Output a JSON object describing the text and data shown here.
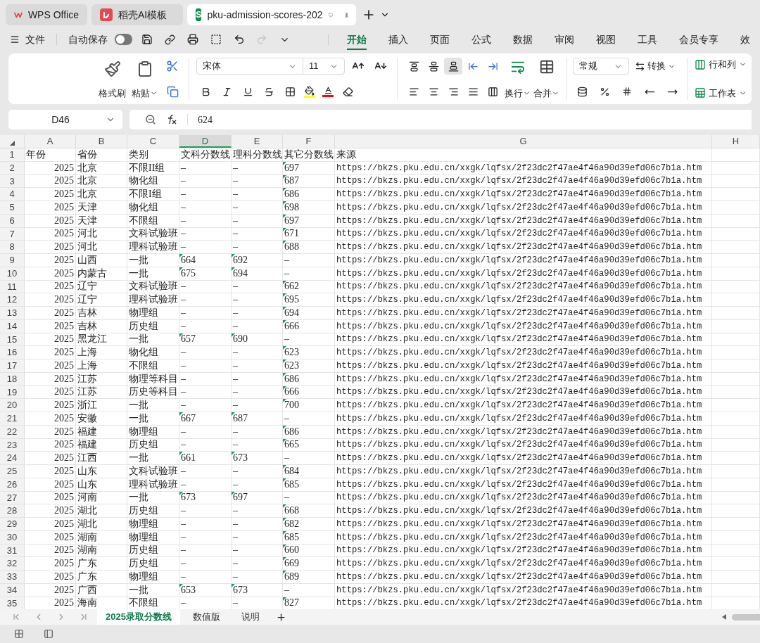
{
  "browser_tabs": [
    {
      "kind": "wps",
      "label": "WPS Office",
      "selected": false
    },
    {
      "kind": "docer",
      "label": "稻壳AI模板",
      "selected": false
    },
    {
      "kind": "sheet",
      "label": "pku-admission-scores-202",
      "icon_letter": "S",
      "selected": true,
      "modified": true
    }
  ],
  "quick_bar": {
    "file_label": "文件",
    "autosave_label": "自动保存",
    "autosave_on": false,
    "redo_disabled": true
  },
  "ribbon_tabs": [
    {
      "label": "开始",
      "selected": true
    },
    {
      "label": "插入",
      "selected": false
    },
    {
      "label": "页面",
      "selected": false
    },
    {
      "label": "公式",
      "selected": false
    },
    {
      "label": "数据",
      "selected": false
    },
    {
      "label": "审阅",
      "selected": false
    },
    {
      "label": "视图",
      "selected": false
    },
    {
      "label": "工具",
      "selected": false
    },
    {
      "label": "会员专享",
      "selected": false
    },
    {
      "label": "效",
      "selected": false
    }
  ],
  "ribbon": {
    "format_painter": "格式刷",
    "paste": "粘贴",
    "font_name": "宋体",
    "font_size": "11",
    "vertical_align_selected": [
      false,
      false,
      true
    ],
    "wrap": "换行",
    "merge": "合并",
    "number_format": "常规",
    "convert": "转换",
    "rows_cols": "行和列",
    "worksheet": "工作表"
  },
  "formula_bar": {
    "cell_ref": "D46",
    "formula": "624"
  },
  "sheet": {
    "columns": [
      {
        "label": "A",
        "selected": false
      },
      {
        "label": "B",
        "selected": false
      },
      {
        "label": "C",
        "selected": false
      },
      {
        "label": "D",
        "selected": true
      },
      {
        "label": "E",
        "selected": false
      },
      {
        "label": "F",
        "selected": false
      },
      {
        "label": "G",
        "selected": false
      },
      {
        "label": "H",
        "selected": false
      }
    ],
    "rows": [
      {
        "number": "1",
        "kind": "header",
        "cells": [
          "年份",
          "省份",
          "类别",
          "文科分数线",
          "理科分数线",
          "其它分数线",
          "来源"
        ],
        "flags": [
          false,
          false,
          false,
          false,
          false,
          false,
          false
        ]
      },
      {
        "number": "2",
        "kind": "data",
        "cells": [
          "2025",
          "北京",
          "不限II组",
          "–",
          "–",
          "697",
          "https://bkzs.pku.edu.cn/xxgk/lqfsx/2f23dc2f47ae4f46a90d39efd06c7b1a.htm"
        ],
        "flags": [
          false,
          false,
          false,
          false,
          false,
          true,
          false
        ]
      },
      {
        "number": "3",
        "kind": "data",
        "cells": [
          "2025",
          "北京",
          "物化组",
          "–",
          "–",
          "687",
          "https://bkzs.pku.edu.cn/xxgk/lqfsx/2f23dc2f47ae4f46a90d39efd06c7b1a.htm"
        ],
        "flags": [
          false,
          false,
          false,
          false,
          false,
          true,
          false
        ]
      },
      {
        "number": "4",
        "kind": "data",
        "cells": [
          "2025",
          "北京",
          "不限I组",
          "–",
          "–",
          "686",
          "https://bkzs.pku.edu.cn/xxgk/lqfsx/2f23dc2f47ae4f46a90d39efd06c7b1a.htm"
        ],
        "flags": [
          false,
          false,
          false,
          false,
          false,
          true,
          false
        ]
      },
      {
        "number": "5",
        "kind": "data",
        "cells": [
          "2025",
          "天津",
          "物化组",
          "–",
          "–",
          "698",
          "https://bkzs.pku.edu.cn/xxgk/lqfsx/2f23dc2f47ae4f46a90d39efd06c7b1a.htm"
        ],
        "flags": [
          false,
          false,
          false,
          false,
          false,
          true,
          false
        ]
      },
      {
        "number": "6",
        "kind": "data",
        "cells": [
          "2025",
          "天津",
          "不限组",
          "–",
          "–",
          "697",
          "https://bkzs.pku.edu.cn/xxgk/lqfsx/2f23dc2f47ae4f46a90d39efd06c7b1a.htm"
        ],
        "flags": [
          false,
          false,
          false,
          false,
          false,
          true,
          false
        ]
      },
      {
        "number": "7",
        "kind": "data",
        "cells": [
          "2025",
          "河北",
          "文科试验班",
          "–",
          "–",
          "671",
          "https://bkzs.pku.edu.cn/xxgk/lqfsx/2f23dc2f47ae4f46a90d39efd06c7b1a.htm"
        ],
        "flags": [
          false,
          false,
          false,
          false,
          false,
          true,
          false
        ]
      },
      {
        "number": "8",
        "kind": "data",
        "cells": [
          "2025",
          "河北",
          "理科试验班",
          "–",
          "–",
          "688",
          "https://bkzs.pku.edu.cn/xxgk/lqfsx/2f23dc2f47ae4f46a90d39efd06c7b1a.htm"
        ],
        "flags": [
          false,
          false,
          false,
          false,
          false,
          true,
          false
        ]
      },
      {
        "number": "9",
        "kind": "data",
        "cells": [
          "2025",
          "山西",
          "一批",
          "664",
          "692",
          "–",
          "https://bkzs.pku.edu.cn/xxgk/lqfsx/2f23dc2f47ae4f46a90d39efd06c7b1a.htm"
        ],
        "flags": [
          false,
          false,
          false,
          true,
          true,
          false,
          false
        ]
      },
      {
        "number": "10",
        "kind": "data",
        "cells": [
          "2025",
          "内蒙古",
          "一批",
          "675",
          "694",
          "–",
          "https://bkzs.pku.edu.cn/xxgk/lqfsx/2f23dc2f47ae4f46a90d39efd06c7b1a.htm"
        ],
        "flags": [
          false,
          false,
          false,
          true,
          true,
          false,
          false
        ]
      },
      {
        "number": "11",
        "kind": "data",
        "cells": [
          "2025",
          "辽宁",
          "文科试验班",
          "–",
          "–",
          "662",
          "https://bkzs.pku.edu.cn/xxgk/lqfsx/2f23dc2f47ae4f46a90d39efd06c7b1a.htm"
        ],
        "flags": [
          false,
          false,
          false,
          false,
          false,
          true,
          false
        ]
      },
      {
        "number": "12",
        "kind": "data",
        "cells": [
          "2025",
          "辽宁",
          "理科试验班",
          "–",
          "–",
          "695",
          "https://bkzs.pku.edu.cn/xxgk/lqfsx/2f23dc2f47ae4f46a90d39efd06c7b1a.htm"
        ],
        "flags": [
          false,
          false,
          false,
          false,
          false,
          true,
          false
        ]
      },
      {
        "number": "13",
        "kind": "data",
        "cells": [
          "2025",
          "吉林",
          "物理组",
          "–",
          "–",
          "694",
          "https://bkzs.pku.edu.cn/xxgk/lqfsx/2f23dc2f47ae4f46a90d39efd06c7b1a.htm"
        ],
        "flags": [
          false,
          false,
          false,
          false,
          false,
          true,
          false
        ]
      },
      {
        "number": "14",
        "kind": "data",
        "cells": [
          "2025",
          "吉林",
          "历史组",
          "–",
          "–",
          "666",
          "https://bkzs.pku.edu.cn/xxgk/lqfsx/2f23dc2f47ae4f46a90d39efd06c7b1a.htm"
        ],
        "flags": [
          false,
          false,
          false,
          false,
          false,
          true,
          false
        ]
      },
      {
        "number": "15",
        "kind": "data",
        "cells": [
          "2025",
          "黑龙江",
          "一批",
          "657",
          "690",
          "–",
          "https://bkzs.pku.edu.cn/xxgk/lqfsx/2f23dc2f47ae4f46a90d39efd06c7b1a.htm"
        ],
        "flags": [
          false,
          false,
          false,
          true,
          true,
          false,
          false
        ]
      },
      {
        "number": "16",
        "kind": "data",
        "cells": [
          "2025",
          "上海",
          "物化组",
          "–",
          "–",
          "623",
          "https://bkzs.pku.edu.cn/xxgk/lqfsx/2f23dc2f47ae4f46a90d39efd06c7b1a.htm"
        ],
        "flags": [
          false,
          false,
          false,
          false,
          false,
          true,
          false
        ]
      },
      {
        "number": "17",
        "kind": "data",
        "cells": [
          "2025",
          "上海",
          "不限组",
          "–",
          "–",
          "623",
          "https://bkzs.pku.edu.cn/xxgk/lqfsx/2f23dc2f47ae4f46a90d39efd06c7b1a.htm"
        ],
        "flags": [
          false,
          false,
          false,
          false,
          false,
          true,
          false
        ]
      },
      {
        "number": "18",
        "kind": "data",
        "cells": [
          "2025",
          "江苏",
          "物理等科目",
          "–",
          "–",
          "686",
          "https://bkzs.pku.edu.cn/xxgk/lqfsx/2f23dc2f47ae4f46a90d39efd06c7b1a.htm"
        ],
        "flags": [
          false,
          false,
          false,
          false,
          false,
          true,
          false
        ]
      },
      {
        "number": "19",
        "kind": "data",
        "cells": [
          "2025",
          "江苏",
          "历史等科目",
          "–",
          "–",
          "666",
          "https://bkzs.pku.edu.cn/xxgk/lqfsx/2f23dc2f47ae4f46a90d39efd06c7b1a.htm"
        ],
        "flags": [
          false,
          false,
          false,
          false,
          false,
          true,
          false
        ]
      },
      {
        "number": "20",
        "kind": "data",
        "cells": [
          "2025",
          "浙江",
          "一批",
          "–",
          "–",
          "700",
          "https://bkzs.pku.edu.cn/xxgk/lqfsx/2f23dc2f47ae4f46a90d39efd06c7b1a.htm"
        ],
        "flags": [
          false,
          false,
          false,
          false,
          false,
          true,
          false
        ]
      },
      {
        "number": "21",
        "kind": "data",
        "cells": [
          "2025",
          "安徽",
          "一批",
          "667",
          "687",
          "–",
          "https://bkzs.pku.edu.cn/xxgk/lqfsx/2f23dc2f47ae4f46a90d39efd06c7b1a.htm"
        ],
        "flags": [
          false,
          false,
          false,
          true,
          true,
          false,
          false
        ]
      },
      {
        "number": "22",
        "kind": "data",
        "cells": [
          "2025",
          "福建",
          "物理组",
          "–",
          "–",
          "686",
          "https://bkzs.pku.edu.cn/xxgk/lqfsx/2f23dc2f47ae4f46a90d39efd06c7b1a.htm"
        ],
        "flags": [
          false,
          false,
          false,
          false,
          false,
          true,
          false
        ]
      },
      {
        "number": "23",
        "kind": "data",
        "cells": [
          "2025",
          "福建",
          "历史组",
          "–",
          "–",
          "665",
          "https://bkzs.pku.edu.cn/xxgk/lqfsx/2f23dc2f47ae4f46a90d39efd06c7b1a.htm"
        ],
        "flags": [
          false,
          false,
          false,
          false,
          false,
          true,
          false
        ]
      },
      {
        "number": "24",
        "kind": "data",
        "cells": [
          "2025",
          "江西",
          "一批",
          "661",
          "673",
          "–",
          "https://bkzs.pku.edu.cn/xxgk/lqfsx/2f23dc2f47ae4f46a90d39efd06c7b1a.htm"
        ],
        "flags": [
          false,
          false,
          false,
          true,
          true,
          false,
          false
        ]
      },
      {
        "number": "25",
        "kind": "data",
        "cells": [
          "2025",
          "山东",
          "文科试验班",
          "–",
          "–",
          "684",
          "https://bkzs.pku.edu.cn/xxgk/lqfsx/2f23dc2f47ae4f46a90d39efd06c7b1a.htm"
        ],
        "flags": [
          false,
          false,
          false,
          false,
          false,
          true,
          false
        ]
      },
      {
        "number": "26",
        "kind": "data",
        "cells": [
          "2025",
          "山东",
          "理科试验班",
          "–",
          "–",
          "685",
          "https://bkzs.pku.edu.cn/xxgk/lqfsx/2f23dc2f47ae4f46a90d39efd06c7b1a.htm"
        ],
        "flags": [
          false,
          false,
          false,
          false,
          false,
          true,
          false
        ]
      },
      {
        "number": "27",
        "kind": "data",
        "cells": [
          "2025",
          "河南",
          "一批",
          "673",
          "697",
          "–",
          "https://bkzs.pku.edu.cn/xxgk/lqfsx/2f23dc2f47ae4f46a90d39efd06c7b1a.htm"
        ],
        "flags": [
          false,
          false,
          false,
          true,
          true,
          false,
          false
        ]
      },
      {
        "number": "28",
        "kind": "data",
        "cells": [
          "2025",
          "湖北",
          "历史组",
          "–",
          "–",
          "668",
          "https://bkzs.pku.edu.cn/xxgk/lqfsx/2f23dc2f47ae4f46a90d39efd06c7b1a.htm"
        ],
        "flags": [
          false,
          false,
          false,
          false,
          false,
          true,
          false
        ]
      },
      {
        "number": "29",
        "kind": "data",
        "cells": [
          "2025",
          "湖北",
          "物理组",
          "–",
          "–",
          "682",
          "https://bkzs.pku.edu.cn/xxgk/lqfsx/2f23dc2f47ae4f46a90d39efd06c7b1a.htm"
        ],
        "flags": [
          false,
          false,
          false,
          false,
          false,
          true,
          false
        ]
      },
      {
        "number": "30",
        "kind": "data",
        "cells": [
          "2025",
          "湖南",
          "物理组",
          "–",
          "–",
          "685",
          "https://bkzs.pku.edu.cn/xxgk/lqfsx/2f23dc2f47ae4f46a90d39efd06c7b1a.htm"
        ],
        "flags": [
          false,
          false,
          false,
          false,
          false,
          true,
          false
        ]
      },
      {
        "number": "31",
        "kind": "data",
        "cells": [
          "2025",
          "湖南",
          "历史组",
          "–",
          "–",
          "660",
          "https://bkzs.pku.edu.cn/xxgk/lqfsx/2f23dc2f47ae4f46a90d39efd06c7b1a.htm"
        ],
        "flags": [
          false,
          false,
          false,
          false,
          false,
          true,
          false
        ]
      },
      {
        "number": "32",
        "kind": "data",
        "cells": [
          "2025",
          "广东",
          "历史组",
          "–",
          "–",
          "669",
          "https://bkzs.pku.edu.cn/xxgk/lqfsx/2f23dc2f47ae4f46a90d39efd06c7b1a.htm"
        ],
        "flags": [
          false,
          false,
          false,
          false,
          false,
          true,
          false
        ]
      },
      {
        "number": "33",
        "kind": "data",
        "cells": [
          "2025",
          "广东",
          "物理组",
          "–",
          "–",
          "689",
          "https://bkzs.pku.edu.cn/xxgk/lqfsx/2f23dc2f47ae4f46a90d39efd06c7b1a.htm"
        ],
        "flags": [
          false,
          false,
          false,
          false,
          false,
          true,
          false
        ]
      },
      {
        "number": "34",
        "kind": "data",
        "cells": [
          "2025",
          "广西",
          "一批",
          "653",
          "673",
          "–",
          "https://bkzs.pku.edu.cn/xxgk/lqfsx/2f23dc2f47ae4f46a90d39efd06c7b1a.htm"
        ],
        "flags": [
          false,
          false,
          false,
          true,
          true,
          false,
          false
        ]
      },
      {
        "number": "35",
        "kind": "data",
        "cells": [
          "2025",
          "海南",
          "不限组",
          "–",
          "–",
          "827",
          "https://bkzs.pku.edu.cn/xxgk/lqfsx/2f23dc2f47ae4f46a90d39efd06c7b1a.htm"
        ],
        "flags": [
          false,
          false,
          false,
          false,
          false,
          true,
          false
        ]
      }
    ]
  },
  "sheet_tabs": [
    {
      "label": "2025录取分数线",
      "selected": true
    },
    {
      "label": "数值版",
      "selected": false
    },
    {
      "label": "说明",
      "selected": false
    }
  ]
}
